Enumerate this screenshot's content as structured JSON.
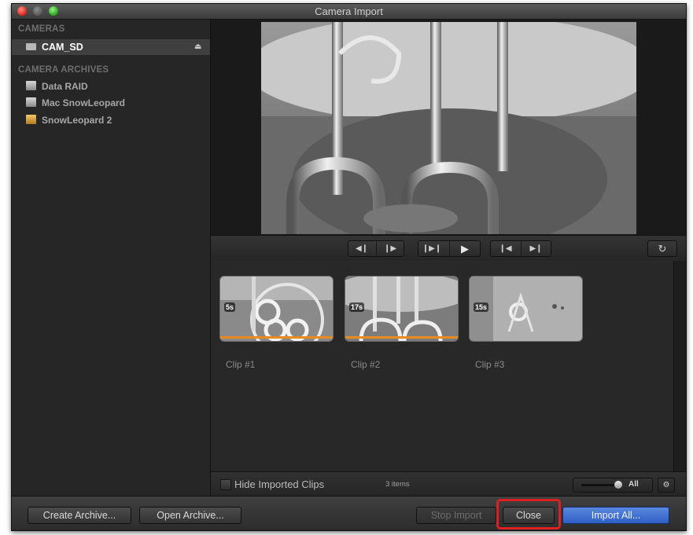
{
  "window": {
    "title": "Camera Import"
  },
  "sidebar": {
    "cameras_header": "CAMERAS",
    "cameras": [
      {
        "label": "CAM_SD",
        "icon": "camera-card-icon",
        "selected": true
      }
    ],
    "archives_header": "CAMERA ARCHIVES",
    "archives": [
      {
        "label": "Data RAID",
        "icon": "drive-icon"
      },
      {
        "label": "Mac SnowLeopard",
        "icon": "drive-icon"
      },
      {
        "label": "SnowLeopard 2",
        "icon": "user-folder-icon"
      }
    ]
  },
  "clips": [
    {
      "name": "Clip #1",
      "duration": "5s"
    },
    {
      "name": "Clip #2",
      "duration": "17s"
    },
    {
      "name": "Clip #3",
      "duration": "15s"
    }
  ],
  "browser_footer": {
    "hide_imported_label": "Hide Imported Clips",
    "item_count": "3 items",
    "zoom_label": "All"
  },
  "buttons": {
    "create_archive": "Create Archive...",
    "open_archive": "Open Archive...",
    "stop_import": "Stop Import",
    "close": "Close",
    "import_all": "Import All..."
  },
  "colors": {
    "accent": "#2d5fc4",
    "progress": "#e88a22",
    "highlight": "#e02020"
  }
}
